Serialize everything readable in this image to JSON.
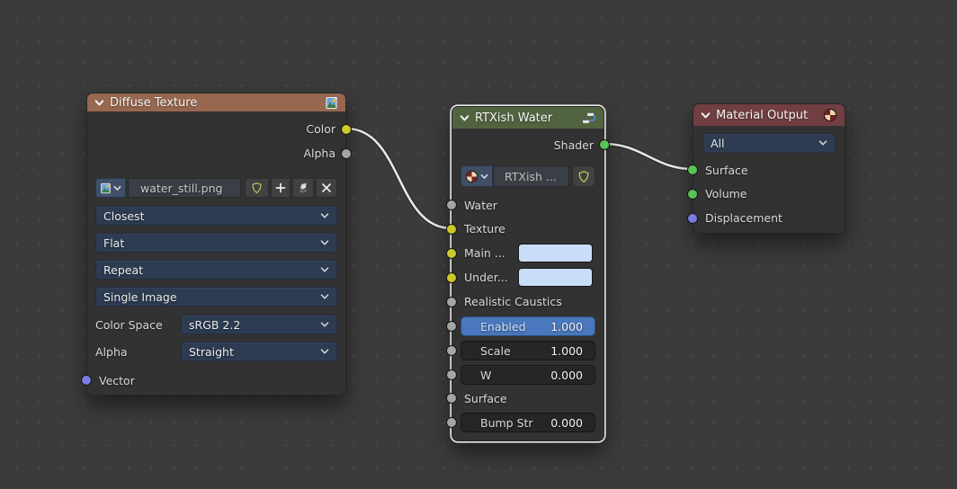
{
  "editor": {
    "background_color": "#3b3b3b",
    "grid_dot_color": "#4d4d4d",
    "wire_color": "#e6e6e6"
  },
  "nodes": {
    "diffuse_texture": {
      "title": "Diffuse Texture",
      "header_color": "#976750",
      "header_icon": "image-icon",
      "outputs": [
        {
          "label": "Color",
          "socket_color": "#ccc82d"
        },
        {
          "label": "Alpha",
          "socket_color": "#a5a5a5"
        }
      ],
      "image_field": {
        "value": "water_still.png"
      },
      "dropdowns": [
        {
          "value": "Closest"
        },
        {
          "value": "Flat"
        },
        {
          "value": "Repeat"
        },
        {
          "value": "Single Image"
        }
      ],
      "properties": [
        {
          "label": "Color Space",
          "value": "sRGB 2.2"
        },
        {
          "label": "Alpha",
          "value": "Straight"
        }
      ],
      "inputs": [
        {
          "label": "Vector",
          "socket_color": "#7b7ce0"
        }
      ]
    },
    "rtxish_water": {
      "title": "RTXish Water",
      "header_color": "#52643f",
      "header_icon": "node-group-icon",
      "selected": true,
      "outputs": [
        {
          "label": "Shader",
          "socket_color": "#58c158"
        }
      ],
      "material_field": {
        "value": "RTXish ..."
      },
      "inputs": [
        {
          "label": "Water",
          "kind": "plain",
          "socket_color": "#a5a5a5"
        },
        {
          "label": "Texture",
          "kind": "plain",
          "socket_color": "#ccc82d"
        },
        {
          "label": "Main ...",
          "kind": "color",
          "socket_color": "#ccc82d",
          "color_value": "#c9ddf8"
        },
        {
          "label": "Under...",
          "kind": "color",
          "socket_color": "#ccc82d",
          "color_value": "#c9ddf8"
        },
        {
          "label": "Realistic Caustics",
          "kind": "plain",
          "socket_color": "#a5a5a5"
        },
        {
          "label": "Enabled",
          "kind": "slider",
          "value": "1.000",
          "socket_color": "#a5a5a5",
          "active": true,
          "active_color": "#4a77bd"
        },
        {
          "label": "Scale",
          "kind": "slider",
          "value": "1.000",
          "socket_color": "#a5a5a5"
        },
        {
          "label": "W",
          "kind": "slider",
          "value": "0.000",
          "socket_color": "#a5a5a5"
        },
        {
          "label": "Surface",
          "kind": "plain",
          "socket_color": "#a5a5a5"
        },
        {
          "label": "Bump Str",
          "kind": "slider",
          "value": "0.000",
          "socket_color": "#a5a5a5"
        }
      ]
    },
    "material_output": {
      "title": "Material Output",
      "header_color": "#713e42",
      "header_icon": "material-icon",
      "target_dropdown": {
        "value": "All"
      },
      "inputs": [
        {
          "label": "Surface",
          "socket_color": "#58c158"
        },
        {
          "label": "Volume",
          "socket_color": "#58c158"
        },
        {
          "label": "Displacement",
          "socket_color": "#7b7ce0"
        }
      ]
    }
  }
}
